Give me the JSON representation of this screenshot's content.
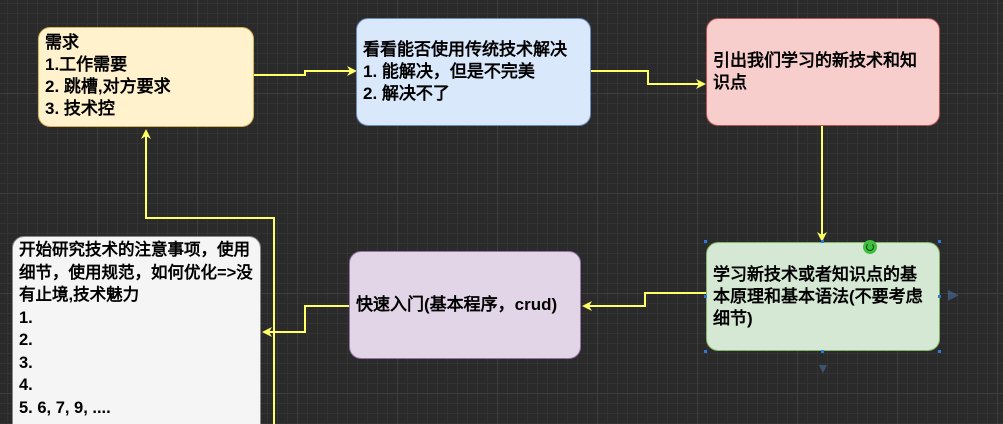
{
  "nodes": {
    "requirements": {
      "lines": [
        "需求",
        "1.工作需要",
        "2. 跳槽,对方要求",
        "3. 技术控"
      ]
    },
    "traditional": {
      "lines": [
        "看看能否使用传统技术解决",
        "1. 能解决，但是不完美",
        "2. 解决不了"
      ]
    },
    "introduce": {
      "text": "引出我们学习的新技术和知识点"
    },
    "learn": {
      "text": "学习新技术或者知识点的基本原理和基本语法(不要考虑细节)"
    },
    "quickstart": {
      "text": "快速入门(基本程序，crud)"
    },
    "notes": {
      "text": "开始研究技术的注意事项，使用细节，使用规范，如何优化=>没有止境,技术魅力",
      "items": [
        "1.",
        "2.",
        "3.",
        "4.",
        "5. 6, 7, 9, ...."
      ]
    }
  },
  "colors": {
    "background": "#2a2a2a",
    "edge": "#ffff66",
    "yellow": "#fff2cc",
    "blue": "#dae8fc",
    "red": "#f8cecc",
    "green": "#d5e8d4",
    "purple": "#e1d5e7",
    "white": "#f5f5f5"
  }
}
